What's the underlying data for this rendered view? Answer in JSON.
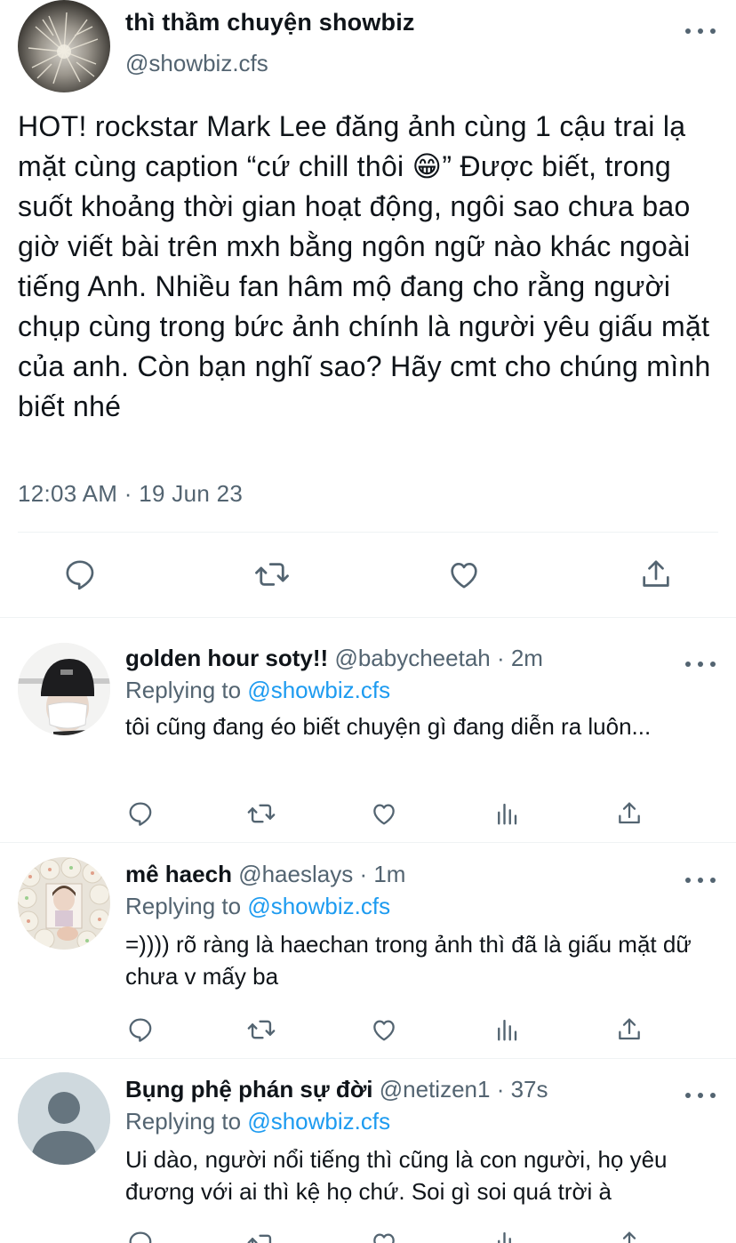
{
  "main_tweet": {
    "display_name": "thì thầm chuyện showbiz",
    "handle": "@showbiz.cfs",
    "text": "HOT! rockstar Mark Lee đăng ảnh cùng 1 cậu trai lạ mặt cùng caption “cứ chill thôi 😁” Được biết, trong suốt khoảng thời gian hoạt động, ngôi sao chưa bao giờ viết bài trên mxh bằng ngôn ngữ nào khác ngoài tiếng Anh. Nhiều fan hâm mộ đang cho rằng người chụp cùng trong bức ảnh chính là người yêu giấu mặt của anh. Còn bạn nghĩ sao? Hãy cmt cho chúng mình biết nhé",
    "timestamp": "12:03 AM · 19 Jun 23",
    "actions": [
      "reply-icon",
      "retweet-icon",
      "like-icon",
      "share-icon"
    ]
  },
  "replies": [
    {
      "display_name": "golden hour soty!!",
      "handle": "@babycheetah",
      "time": "· 2m",
      "replying_prefix": "Replying to ",
      "replying_to": "@showbiz.cfs",
      "text": "tôi cũng đang éo biết chuyện gì đang diễn ra luôn..."
    },
    {
      "display_name": "mê haech",
      "handle": "@haeslays",
      "time": "· 1m",
      "replying_prefix": "Replying to ",
      "replying_to": "@showbiz.cfs",
      "text": "=)))) rõ ràng là haechan trong ảnh thì đã là giấu mặt dữ chưa v mấy ba"
    },
    {
      "display_name": "Bụng phệ phán sự đời",
      "handle": "@netizen1",
      "time": "· 37s",
      "replying_prefix": "Replying to ",
      "replying_to": "@showbiz.cfs",
      "text": "Ui dào, người nổi tiếng thì cũng là con người, họ yêu đương với ai thì kệ họ chứ. Soi gì soi quá trời à"
    }
  ],
  "reply_actions": [
    "reply-icon",
    "retweet-icon",
    "like-icon",
    "analytics-icon",
    "share-icon"
  ],
  "colors": {
    "text": "#0f1419",
    "secondary": "#536471",
    "link": "#1d9bf0",
    "divider": "#eff3f4"
  }
}
